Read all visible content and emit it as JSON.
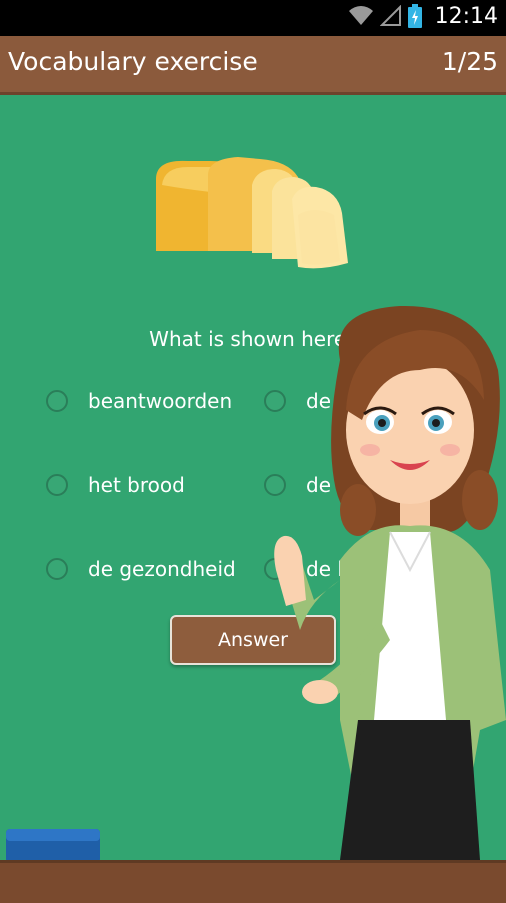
{
  "status_bar": {
    "time": "12:14"
  },
  "header": {
    "title": "Vocabulary exercise",
    "progress": "1/25"
  },
  "question": {
    "text": "What is shown here?"
  },
  "options": [
    {
      "label": "beantwoorden"
    },
    {
      "label": "de tempel"
    },
    {
      "label": "het brood"
    },
    {
      "label": "de woonkamer"
    },
    {
      "label": "de gezondheid"
    },
    {
      "label": "de lolly"
    }
  ],
  "answer_button": {
    "label": "Answer"
  },
  "colors": {
    "board": "#32a571",
    "header": "#8b5a3c",
    "button": "#8e5d3d"
  },
  "icons": [
    "wifi-icon",
    "signal-icon",
    "battery-icon",
    "bread-image",
    "teacher-illustration",
    "eraser-image"
  ]
}
